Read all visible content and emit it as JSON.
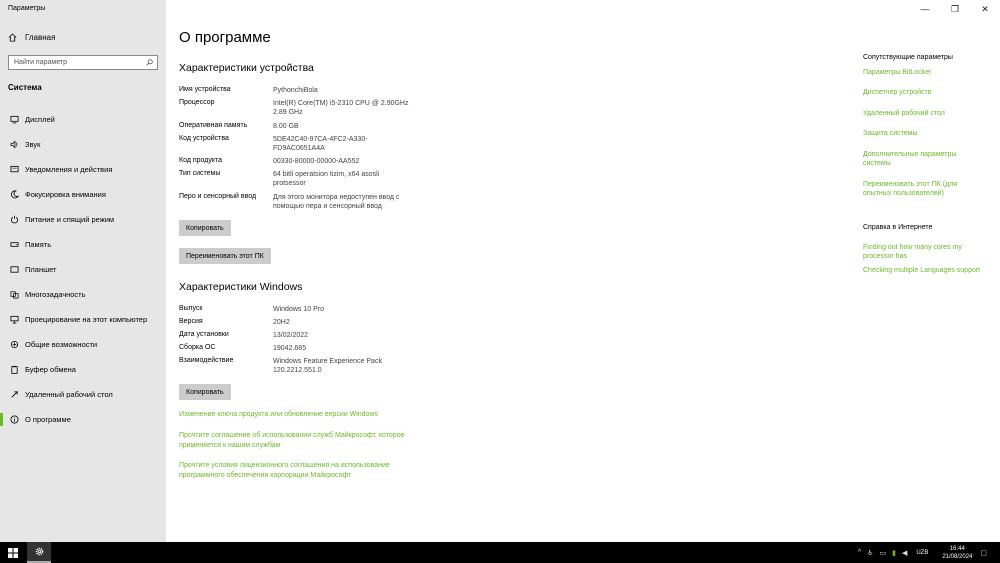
{
  "window": {
    "title": "Параметры",
    "minimize": "—",
    "maximize": "❐",
    "close": "✕"
  },
  "sidebar": {
    "home_label": "Главная",
    "search_placeholder": "Найти параметр",
    "section_title": "Система",
    "items": [
      {
        "label": "Дисплей",
        "icon": "display-icon"
      },
      {
        "label": "Звук",
        "icon": "sound-icon"
      },
      {
        "label": "Уведомления и действия",
        "icon": "notifications-icon"
      },
      {
        "label": "Фокусировка внимания",
        "icon": "moon-icon"
      },
      {
        "label": "Питание и спящий режим",
        "icon": "power-icon"
      },
      {
        "label": "Память",
        "icon": "storage-icon"
      },
      {
        "label": "Планшет",
        "icon": "tablet-icon"
      },
      {
        "label": "Многозадачность",
        "icon": "multitasking-icon"
      },
      {
        "label": "Проецирование на этот компьютер",
        "icon": "projecting-icon"
      },
      {
        "label": "Общие возможности",
        "icon": "shared-icon"
      },
      {
        "label": "Буфер обмена",
        "icon": "clipboard-icon"
      },
      {
        "label": "Удаленный рабочий стол",
        "icon": "remote-desktop-icon"
      },
      {
        "label": "О программе",
        "icon": "info-icon",
        "active": true
      }
    ]
  },
  "main": {
    "title": "О программе",
    "device_specs": {
      "heading": "Характеристики устройства",
      "rows": [
        {
          "label": "Имя устройства",
          "value": "PythonchiBola"
        },
        {
          "label": "Процессор",
          "value": "Intel(R) Core(TM) i5-2310 CPU @ 2.90GHz 2.89 GHz"
        },
        {
          "label": "Оперативная память",
          "value": "8.00 GB"
        },
        {
          "label": "Код устройства",
          "value": "5DE42C40-97CA-4FC2-A330-FD9AC0651A4A"
        },
        {
          "label": "Код продукта",
          "value": "00330-80000-00000-AA552"
        },
        {
          "label": "Тип системы",
          "value": "64 bitli operatsion tizim, x64 asosli protsessor"
        },
        {
          "label": "Перо и сенсорный ввод",
          "value": "Для этого монитора недоступен ввод с помощью пера и сенсорный ввод"
        }
      ],
      "copy_button": "Копировать",
      "rename_button": "Переименовать этот ПК"
    },
    "windows_specs": {
      "heading": "Характеристики Windows",
      "rows": [
        {
          "label": "Выпуск",
          "value": "Windows 10 Pro"
        },
        {
          "label": "Версия",
          "value": "20H2"
        },
        {
          "label": "Дата установки",
          "value": "13/02/2022"
        },
        {
          "label": "Сборка ОС",
          "value": "19042.685"
        },
        {
          "label": "Взаимодействие",
          "value": "Windows Feature Experience Pack 120.2212.551.0"
        }
      ],
      "copy_button": "Копировать"
    },
    "links": [
      "Изменение ключа продукта или обновление версии Windows",
      "Прочтите соглашение об использовании служб Майкрософт, которое применяется к нашим службам",
      "Прочтите условия лицензионного соглашения на использование программного обеспечения корпорации Майкрософт"
    ]
  },
  "right": {
    "related_heading": "Сопутствующие параметры",
    "related_links": [
      "Параметры BitLocker",
      "Диспетчер устройств",
      "Удаленный рабочий стол",
      "Защита системы",
      "Дополнительные параметры системы",
      "Переименовать этот ПК (для опытных пользователей)"
    ],
    "web_heading": "Справка в Интернете",
    "web_links": [
      "Finding out how many cores my processor has",
      "Checking multiple Languages support"
    ]
  },
  "taskbar": {
    "language": "UZB",
    "time": "16:44",
    "date": "21/08/2024"
  },
  "colors": {
    "accent": "#6cb82b",
    "sidebar_bg": "#e6e6e6",
    "button_bg": "#cccccc"
  }
}
